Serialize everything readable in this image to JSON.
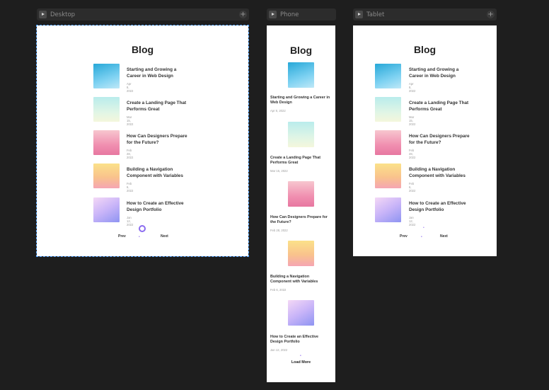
{
  "frames": {
    "desktop": {
      "label": "Desktop"
    },
    "phone": {
      "label": "Phone"
    },
    "tablet": {
      "label": "Tablet"
    }
  },
  "blog": {
    "title": "Blog",
    "posts": [
      {
        "title": "Starting and Growing a Career in Web Design",
        "date": "Apr 8, 2022",
        "thumb": "feather-image"
      },
      {
        "title": "Create a Landing Page That Performs Great",
        "date": "Mar 15, 2022",
        "thumb": "dandelion-image"
      },
      {
        "title": "How Can Designers Prepare for the Future?",
        "date": "Feb 28, 2022",
        "thumb": "pink-plant-image"
      },
      {
        "title": "Building a Navigation Component with Variables",
        "date": "Feb 6, 2022",
        "thumb": "yellow-flower-image"
      },
      {
        "title": "How to Create an Effective Design Portfolio",
        "date": "Jan 12, 2022",
        "thumb": "purple-plant-image"
      }
    ],
    "pager": {
      "prev": "Prev",
      "next": "Next",
      "dot": "•"
    },
    "load_more": "Load More"
  },
  "colors": {
    "canvas": "#1e1e1e",
    "accent": "#8b6cf0",
    "selection": "#4d9fff"
  }
}
